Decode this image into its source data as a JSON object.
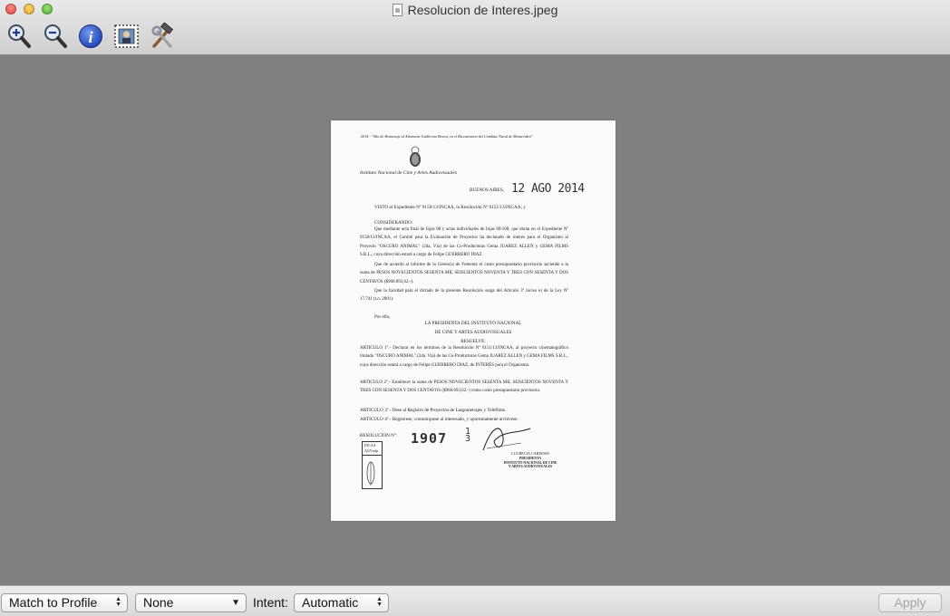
{
  "window": {
    "title": "Resolucion de Interes.jpeg"
  },
  "toolbar": {
    "tools": [
      {
        "name": "zoom-in",
        "icon": "magnifier-plus-icon"
      },
      {
        "name": "zoom-out",
        "icon": "magnifier-minus-icon"
      },
      {
        "name": "info",
        "icon": "info-icon"
      },
      {
        "name": "image-select",
        "icon": "selection-image-icon"
      },
      {
        "name": "adjust-tools",
        "icon": "hammer-wrench-icon"
      }
    ]
  },
  "document": {
    "header_motto": "2014 - \"Año de Homenaje al Almirante Guillermo Brown, en el Bicentenario del Combate Naval de Montevideo\"",
    "institute": "Instituto Nacional de Cine y Artes Audiovisuales",
    "place": "BUENOS AIRES,",
    "date_stamp": "12 AGO 2014",
    "visto": "VISTO el Expediente Nº 9158/13/INCAA, la Resolución Nº 0151/13/INCAA; y",
    "considerando_heading": "CONSIDERANDO:",
    "considerando_p1": "Que mediante acta final de fojas 98 y actas individuales de fojas 99/108, que obran en el Expediente Nº 9158/13/INCAA, el Comité para la Evaluación de Proyectos ha declarado de interés para el Organismo al Proyecto \"OSCURO ANIMAL\" (2da. Vía) de las Co-Productoras Gema JUAREZ ALLEN y GEMA FILMS S.R.L., cuya dirección estará a cargo de Felipe GUERRERO DIAZ.",
    "considerando_p2": "Que de acuerdo al informe de la Gerencia de Fomento el costo presupuestario provisorio asciende a la suma de PESOS NOVECIENTOS SESENTA MIL SEISCIENTOS NOVENTA Y TRES CON SESENTA Y DOS CENTAVOS ($960.693,62.-).",
    "considerando_p3": "Que la facultad para el dictado de la presente Resolución surge del Artículo 3º inciso e) de la Ley Nº 17.741 (t.o. 2001).",
    "por_ello": "Por ello,",
    "presidenta_line1": "LA PRESIDENTA DEL INSTITUTO NACIONAL",
    "presidenta_line2": "DE CINE Y ARTES AUDIOVISUALES",
    "resuelve": "RESUELVE:",
    "articulo1": "ARTICULO 1º.- Declarar en los términos de la Resolución Nº 0151/13/INCAA, al proyecto cinematográfico titulado \"OSCURO ANIMAL\" (2da. Vía) de las Co-Productoras Gema JUAREZ ALLEN y GEMA FILMS S.R.L., cuya dirección estará a cargo de Felipe GUERRERO DIAZ, de INTERÉS para el Organismo.",
    "articulo2": "ARTICULO 2º.- Establecer la suma de PESOS NOVECIENTOS SESENTA MIL SEISCIENTOS NOVENTA Y TRES CON SESENTA Y DOS CENTAVOS ($960.693,62.-) como costo presupuestario provisorio.",
    "articulo3": "ARTICULO 3º.- Dese al Registro de Proyectos de Largometrajes y Telefilms.",
    "articulo4": "ARTICULO 4º.- Regístrese, comuníquese al interesado, y oportunamente archívese.",
    "resolucion_label": "RESOLUCION Nº:",
    "resolucion_number": "1907",
    "box_line1": "INCAA",
    "box_line2": "AGVmfp",
    "signature_name": "LUCRECIA CARDOSO",
    "signature_title1": "PRESIDENTA",
    "signature_title2": "INSTITUTO NACIONAL DE CINE",
    "signature_title3": "Y ARTES AUDIOVISUALES"
  },
  "bottombar": {
    "profile_popup": "Match to Profile",
    "second_popup": "None",
    "intent_label": "Intent:",
    "intent_popup": "Automatic",
    "apply_label": "Apply"
  }
}
